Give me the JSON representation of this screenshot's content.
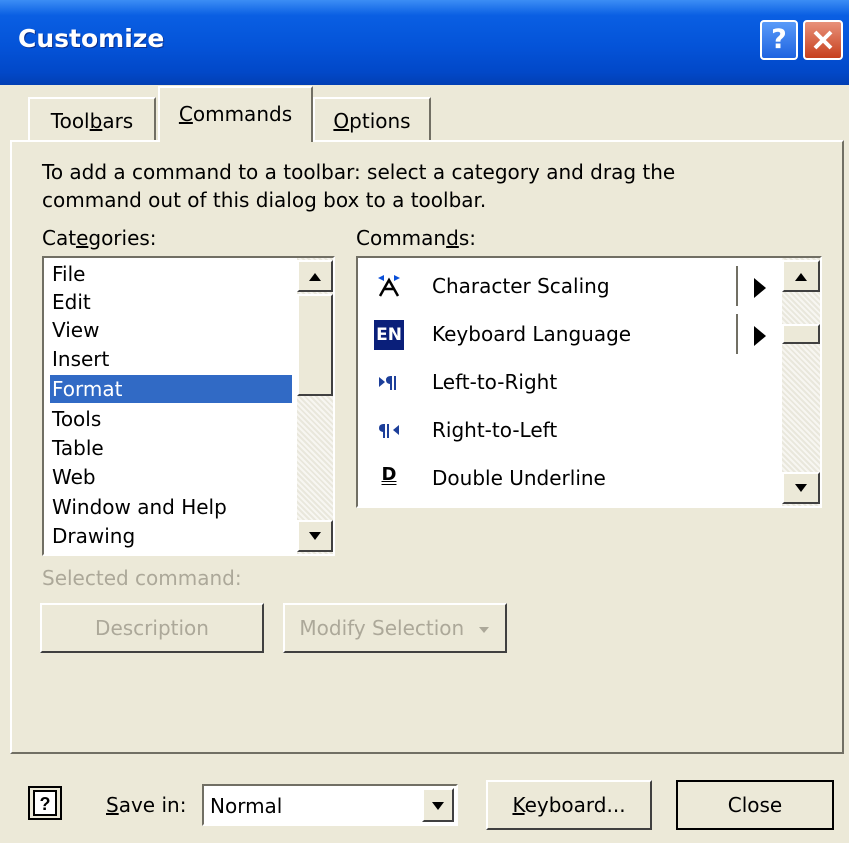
{
  "window": {
    "title": "Customize"
  },
  "tabs": [
    {
      "label_pre": "Tool",
      "label_ul": "b",
      "label_post": "ars"
    },
    {
      "label_pre": "",
      "label_ul": "C",
      "label_post": "ommands"
    },
    {
      "label_pre": "",
      "label_ul": "O",
      "label_post": "ptions"
    }
  ],
  "instructions": "To add a command to a toolbar: select a category and drag the command out of this dialog box to a toolbar.",
  "categories": {
    "label_pre": "Cat",
    "label_ul": "e",
    "label_post": "gories:",
    "items": [
      "File",
      "Edit",
      "View",
      "Insert",
      "Format",
      "Tools",
      "Table",
      "Web",
      "Window and Help",
      "Drawing"
    ],
    "selected": "Format"
  },
  "commands": {
    "label_pre": "Comman",
    "label_ul": "d",
    "label_post": "s:",
    "items": [
      {
        "label": "Character Scaling",
        "icon": "character-scaling-icon",
        "has_submenu": true
      },
      {
        "label": "Keyboard Language",
        "icon": "keyboard-language-icon",
        "icon_text": "EN",
        "has_submenu": true
      },
      {
        "label": "Left-to-Right",
        "icon": "left-to-right-icon",
        "has_submenu": false
      },
      {
        "label": "Right-to-Left",
        "icon": "right-to-left-icon",
        "has_submenu": false
      },
      {
        "label": "Double Underline",
        "icon": "double-underline-icon",
        "icon_text": "D",
        "has_submenu": false
      }
    ]
  },
  "selected_command_label": "Selected command:",
  "buttons": {
    "description": "Description",
    "modify_selection": "Modify Selection",
    "keyboard_ul": "K",
    "keyboard_rest": "eyboard...",
    "close": "Close"
  },
  "save_in": {
    "label_ul": "S",
    "label_rest": "ave in:",
    "value": "Normal"
  },
  "colors": {
    "titlebar": "#0453d8",
    "selection": "#316ac5",
    "dialog_bg": "#ece9d8",
    "disabled_text": "#aca899"
  }
}
